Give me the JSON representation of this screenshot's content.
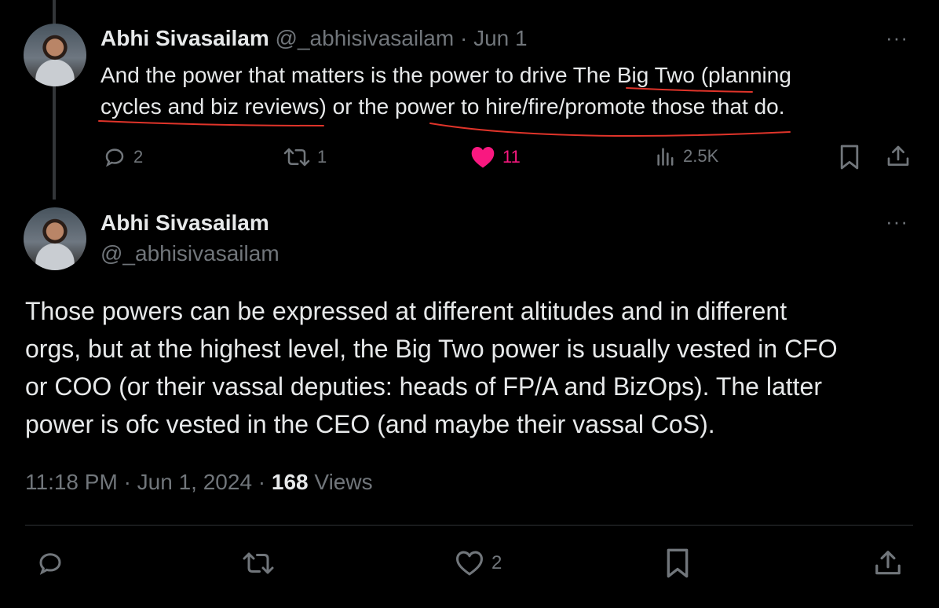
{
  "reply_tweet": {
    "author_name": "Abhi Sivasailam",
    "author_handle": "@_abhisivasailam",
    "separator": "·",
    "date": "Jun 1",
    "text_line1": "And the power that matters is the power to drive The Big Two (planning",
    "text_line2": "cycles and biz reviews) or the power to hire/fire/promote those that do.",
    "replies": "2",
    "reposts": "1",
    "likes": "11",
    "views": "2.5K",
    "liked_color": "#f91880",
    "annotation_color": "#e0342a"
  },
  "main_tweet": {
    "author_name": "Abhi Sivasailam",
    "author_handle": "@_abhisivasailam",
    "text_line1": "Those powers can be expressed at different altitudes and in different",
    "text_line2": "orgs, but at the highest level, the Big Two power is usually vested in CFO",
    "text_line3": "or COO (or their vassal deputies: heads of FP/A and BizOps). The latter",
    "text_line4": "power is ofc vested in the CEO (and maybe their vassal CoS).",
    "time": "11:18 PM",
    "dot1": "·",
    "date": "Jun 1, 2024",
    "dot2": "·",
    "views_count": "168",
    "views_label": "Views",
    "likes": "2"
  },
  "more_glyph": "···",
  "icons": [
    "reply-icon",
    "repost-icon",
    "like-icon",
    "views-icon",
    "bookmark-icon",
    "share-icon"
  ]
}
